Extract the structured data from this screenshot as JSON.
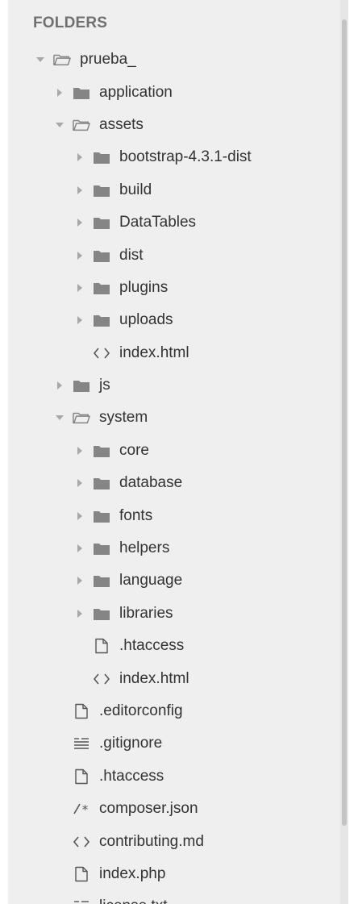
{
  "sidebar": {
    "header": "FOLDERS",
    "tree": [
      {
        "label": "prueba_",
        "type": "folder-open",
        "depth": 0,
        "expanded": true
      },
      {
        "label": "application",
        "type": "folder",
        "depth": 1,
        "expanded": false
      },
      {
        "label": "assets",
        "type": "folder-open",
        "depth": 1,
        "expanded": true
      },
      {
        "label": "bootstrap-4.3.1-dist",
        "type": "folder",
        "depth": 2,
        "expanded": false
      },
      {
        "label": "build",
        "type": "folder",
        "depth": 2,
        "expanded": false
      },
      {
        "label": "DataTables",
        "type": "folder",
        "depth": 2,
        "expanded": false
      },
      {
        "label": "dist",
        "type": "folder",
        "depth": 2,
        "expanded": false
      },
      {
        "label": "plugins",
        "type": "folder",
        "depth": 2,
        "expanded": false
      },
      {
        "label": "uploads",
        "type": "folder",
        "depth": 2,
        "expanded": false
      },
      {
        "label": "index.html",
        "type": "file-html",
        "depth": 2
      },
      {
        "label": "js",
        "type": "folder",
        "depth": 1,
        "expanded": false
      },
      {
        "label": "system",
        "type": "folder-open",
        "depth": 1,
        "expanded": true
      },
      {
        "label": "core",
        "type": "folder",
        "depth": 2,
        "expanded": false
      },
      {
        "label": "database",
        "type": "folder",
        "depth": 2,
        "expanded": false
      },
      {
        "label": "fonts",
        "type": "folder",
        "depth": 2,
        "expanded": false
      },
      {
        "label": "helpers",
        "type": "folder",
        "depth": 2,
        "expanded": false
      },
      {
        "label": "language",
        "type": "folder",
        "depth": 2,
        "expanded": false
      },
      {
        "label": "libraries",
        "type": "folder",
        "depth": 2,
        "expanded": false
      },
      {
        "label": ".htaccess",
        "type": "file",
        "depth": 2
      },
      {
        "label": "index.html",
        "type": "file-html",
        "depth": 2
      },
      {
        "label": ".editorconfig",
        "type": "file",
        "depth": 1
      },
      {
        "label": ".gitignore",
        "type": "file-text",
        "depth": 1
      },
      {
        "label": ".htaccess",
        "type": "file",
        "depth": 1
      },
      {
        "label": "composer.json",
        "type": "file-json",
        "depth": 1
      },
      {
        "label": "contributing.md",
        "type": "file-html",
        "depth": 1
      },
      {
        "label": "index.php",
        "type": "file",
        "depth": 1
      },
      {
        "label": "license.txt",
        "type": "file-text",
        "depth": 1
      }
    ]
  },
  "icons": {
    "folder-closed": "folder-icon",
    "folder-open": "folder-open-icon",
    "file": "file-icon",
    "file-html": "code-brackets-icon",
    "file-text": "text-lines-icon",
    "file-json": "comment-icon"
  },
  "colors": {
    "panel_bg": "#efefef",
    "text": "#333333",
    "header": "#707070",
    "folder": "#858585",
    "arrow": "#a8a8a8"
  }
}
